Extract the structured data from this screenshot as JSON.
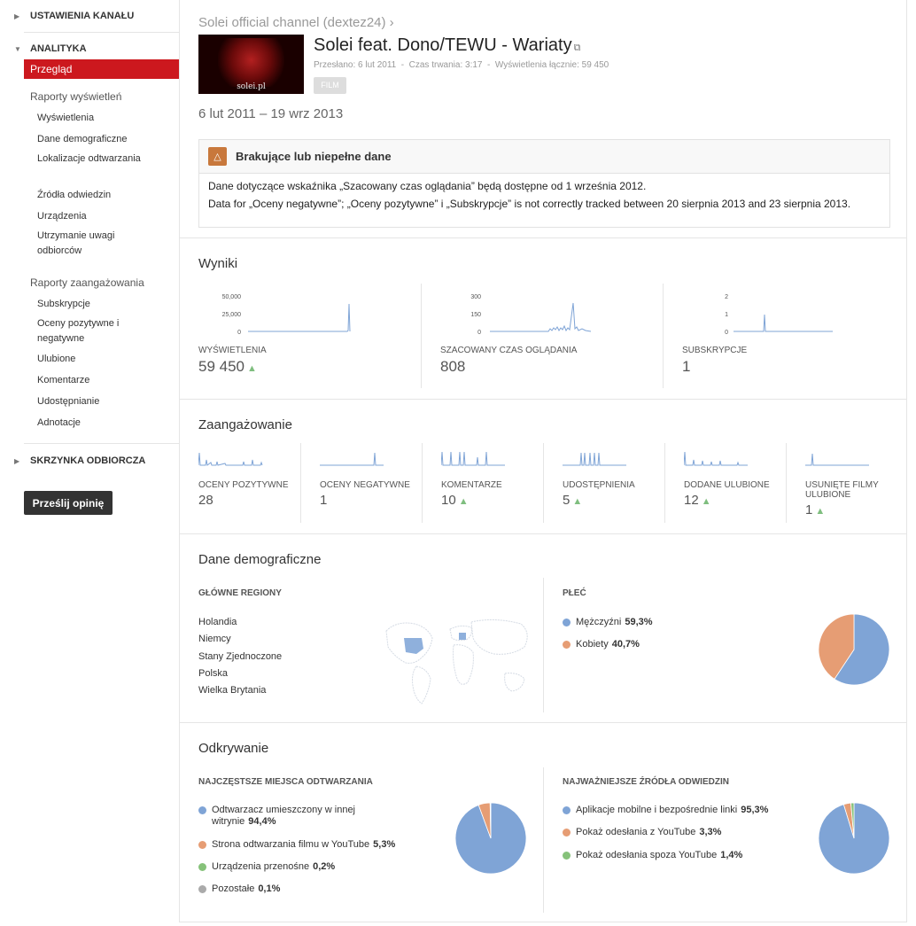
{
  "sidebar": {
    "channel_settings": "USTAWIENIA KANAŁU",
    "analytics": "ANALITYKA",
    "overview": "Przegląd",
    "views_reports_title": "Raporty wyświetleń",
    "views_reports": [
      "Wyświetlenia",
      "Dane demograficzne",
      "Lokalizacje odtwarzania",
      "Źródła odwiedzin",
      "Urządzenia",
      "Utrzymanie uwagi odbiorców"
    ],
    "engagement_reports_title": "Raporty zaangażowania",
    "engagement_reports": [
      "Subskrypcje",
      "Oceny pozytywne i negatywne",
      "Ulubione",
      "Komentarze",
      "Udostępnianie",
      "Adnotacje"
    ],
    "inbox": "SKRZYNKA ODBIORCZA",
    "feedback": "Prześlij opinię"
  },
  "header": {
    "breadcrumb": "Solei official channel (dextez24) ›",
    "title": "Solei feat. Dono/TEWU - Wariaty",
    "meta": "Przesłano: 6 lut 2011  -  Czas trwania: 3:17  -  Wyświetlenia łącznie: 59 450",
    "badge": "FILM",
    "thumb_text": "solei.pl",
    "date_range": "6 lut 2011 – 19 wrz 2013"
  },
  "alert": {
    "title": "Brakujące lub niepełne dane",
    "line1": "Dane dotyczące wskaźnika „Szacowany czas oglądania” będą dostępne od 1 września 2012.",
    "line2": "Data for „Oceny negatywne”; „Oceny pozytywne” i „Subskrypcje” is not correctly tracked between 20 sierpnia 2013 and 23 sierpnia 2013."
  },
  "results": {
    "title": "Wyniki",
    "metrics": [
      {
        "label": "WYŚWIETLENIA",
        "value": "59 450",
        "up": true,
        "ticks": [
          "50,000",
          "25,000",
          "0"
        ]
      },
      {
        "label": "SZACOWANY CZAS OGLĄDANIA",
        "value": "808",
        "up": false,
        "ticks": [
          "300",
          "150",
          "0"
        ]
      },
      {
        "label": "SUBSKRYPCJE",
        "value": "1",
        "up": false,
        "ticks": [
          "2",
          "1",
          "0"
        ]
      }
    ]
  },
  "engagement": {
    "title": "Zaangażowanie",
    "metrics": [
      {
        "label": "OCENY POZYTYWNE",
        "value": "28",
        "up": false
      },
      {
        "label": "OCENY NEGATYWNE",
        "value": "1",
        "up": false
      },
      {
        "label": "KOMENTARZE",
        "value": "10",
        "up": true
      },
      {
        "label": "UDOSTĘPNIENIA",
        "value": "5",
        "up": true
      },
      {
        "label": "DODANE ULUBIONE",
        "value": "12",
        "up": true
      },
      {
        "label": "USUNIĘTE FILMY ULUBIONE",
        "value": "1",
        "up": true
      }
    ],
    "up_glyph": "▲"
  },
  "demographics": {
    "title": "Dane demograficzne",
    "regions_title": "GŁÓWNE REGIONY",
    "regions": [
      "Holandia",
      "Niemcy",
      "Stany Zjednoczone",
      "Polska",
      "Wielka Brytania"
    ],
    "gender_title": "PŁEĆ",
    "gender": [
      {
        "label": "Mężczyźni",
        "pct": "59,3%",
        "value": 59.3,
        "color": "#7fa4d6"
      },
      {
        "label": "Kobiety",
        "pct": "40,7%",
        "value": 40.7,
        "color": "#e69d74"
      }
    ]
  },
  "discovery": {
    "title": "Odkrywanie",
    "places_title": "NAJCZĘSTSZE MIEJSCA ODTWARZANIA",
    "places": [
      {
        "label": "Odtwarzacz umieszczony w innej witrynie",
        "pct": "94,4%",
        "value": 94.4,
        "color": "#7fa4d6"
      },
      {
        "label": "Strona odtwarzania filmu w YouTube",
        "pct": "5,3%",
        "value": 5.3,
        "color": "#e69d74"
      },
      {
        "label": "Urządzenia przenośne",
        "pct": "0,2%",
        "value": 0.2,
        "color": "#86c27a"
      },
      {
        "label": "Pozostałe",
        "pct": "0,1%",
        "value": 0.1,
        "color": "#aaaaaa"
      }
    ],
    "sources_title": "NAJWAŻNIEJSZE ŹRÓDŁA ODWIEDZIN",
    "sources": [
      {
        "label": "Aplikacje mobilne i bezpośrednie linki",
        "pct": "95,3%",
        "value": 95.3,
        "color": "#7fa4d6"
      },
      {
        "label": "Pokaż odesłania z YouTube",
        "pct": "3,3%",
        "value": 3.3,
        "color": "#e69d74"
      },
      {
        "label": "Pokaż odesłania spoza YouTube",
        "pct": "1,4%",
        "value": 1.4,
        "color": "#86c27a"
      }
    ]
  },
  "colors": {
    "accent": "#cc181e",
    "spark": "#7fa4d6",
    "up": "#7fbe7f"
  }
}
